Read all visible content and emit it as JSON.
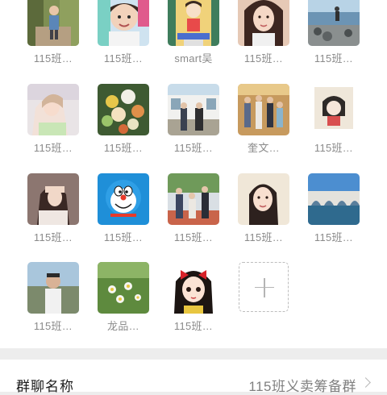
{
  "members": [
    {
      "name": "115班…",
      "avatar": "outdoor-child-photo"
    },
    {
      "name": "115班…",
      "avatar": "boy-portrait-photo"
    },
    {
      "name": "smart吴",
      "avatar": "cartoon-poster-photo"
    },
    {
      "name": "115班…",
      "avatar": "woman-portrait-photo"
    },
    {
      "name": "115班…",
      "avatar": "beach-photo"
    },
    {
      "name": "115班…",
      "avatar": "hazy-girl-photo"
    },
    {
      "name": "115班…",
      "avatar": "flowers-photo"
    },
    {
      "name": "115班…",
      "avatar": "couple-street-photo"
    },
    {
      "name": "奎文…",
      "avatar": "family-photo"
    },
    {
      "name": "115班…",
      "avatar": "drawn-girl-sketch"
    },
    {
      "name": "115班…",
      "avatar": "girl-hand-photo"
    },
    {
      "name": "115班…",
      "avatar": "doraemon-cartoon"
    },
    {
      "name": "115班…",
      "avatar": "family-outdoor-photo"
    },
    {
      "name": "115班…",
      "avatar": "woman-selfie-photo"
    },
    {
      "name": "115班…",
      "avatar": "bridge-photo"
    },
    {
      "name": "115班…",
      "avatar": "man-portrait-photo"
    },
    {
      "name": "龙品…",
      "avatar": "daisy-field-photo"
    },
    {
      "name": "115班…",
      "avatar": "snow-white-cartoon"
    }
  ],
  "add_member": {
    "icon": "plus-icon"
  },
  "group_name_row": {
    "label": "群聊名称",
    "value": "115班义卖筹备群",
    "icon": "chevron-right-icon"
  }
}
